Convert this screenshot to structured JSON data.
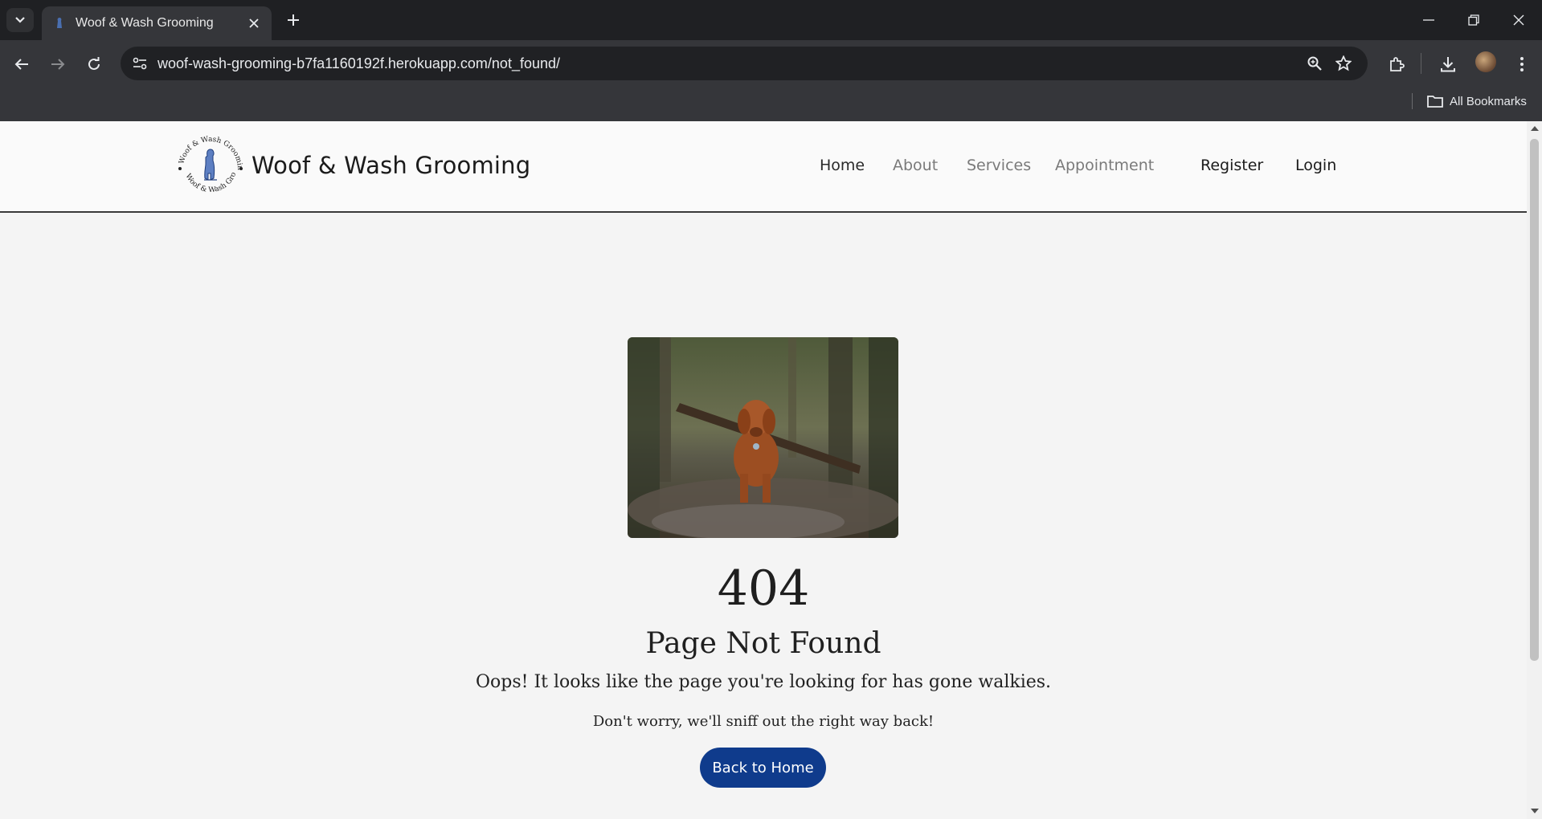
{
  "browser": {
    "tab_title": "Woof & Wash Grooming",
    "url_host": "woof-wash-grooming-b7fa1160192f.herokuapp.com",
    "url_path": "/not_found/",
    "bookmarks_label": "All Bookmarks"
  },
  "header": {
    "brand": "Woof & Wash Grooming",
    "logo_ring_text": "Woof & Wash Grooming",
    "nav": [
      {
        "label": "Home"
      },
      {
        "label": "About"
      },
      {
        "label": "Services"
      },
      {
        "label": "Appointment"
      }
    ],
    "register_label": "Register",
    "login_label": "Login"
  },
  "main": {
    "image_alt": "Brown puppy carrying a large stick on a forest path",
    "error_code": "404",
    "title": "Page Not Found",
    "message": "Oops! It looks like the page you're looking for has gone walkies.",
    "submessage": "Don't worry, we'll sniff out the right way back!",
    "button_label": "Back to Home"
  },
  "colors": {
    "accent_button": "#0f3b8c",
    "page_bg": "#f4f4f4",
    "header_bg": "#fafafa"
  }
}
